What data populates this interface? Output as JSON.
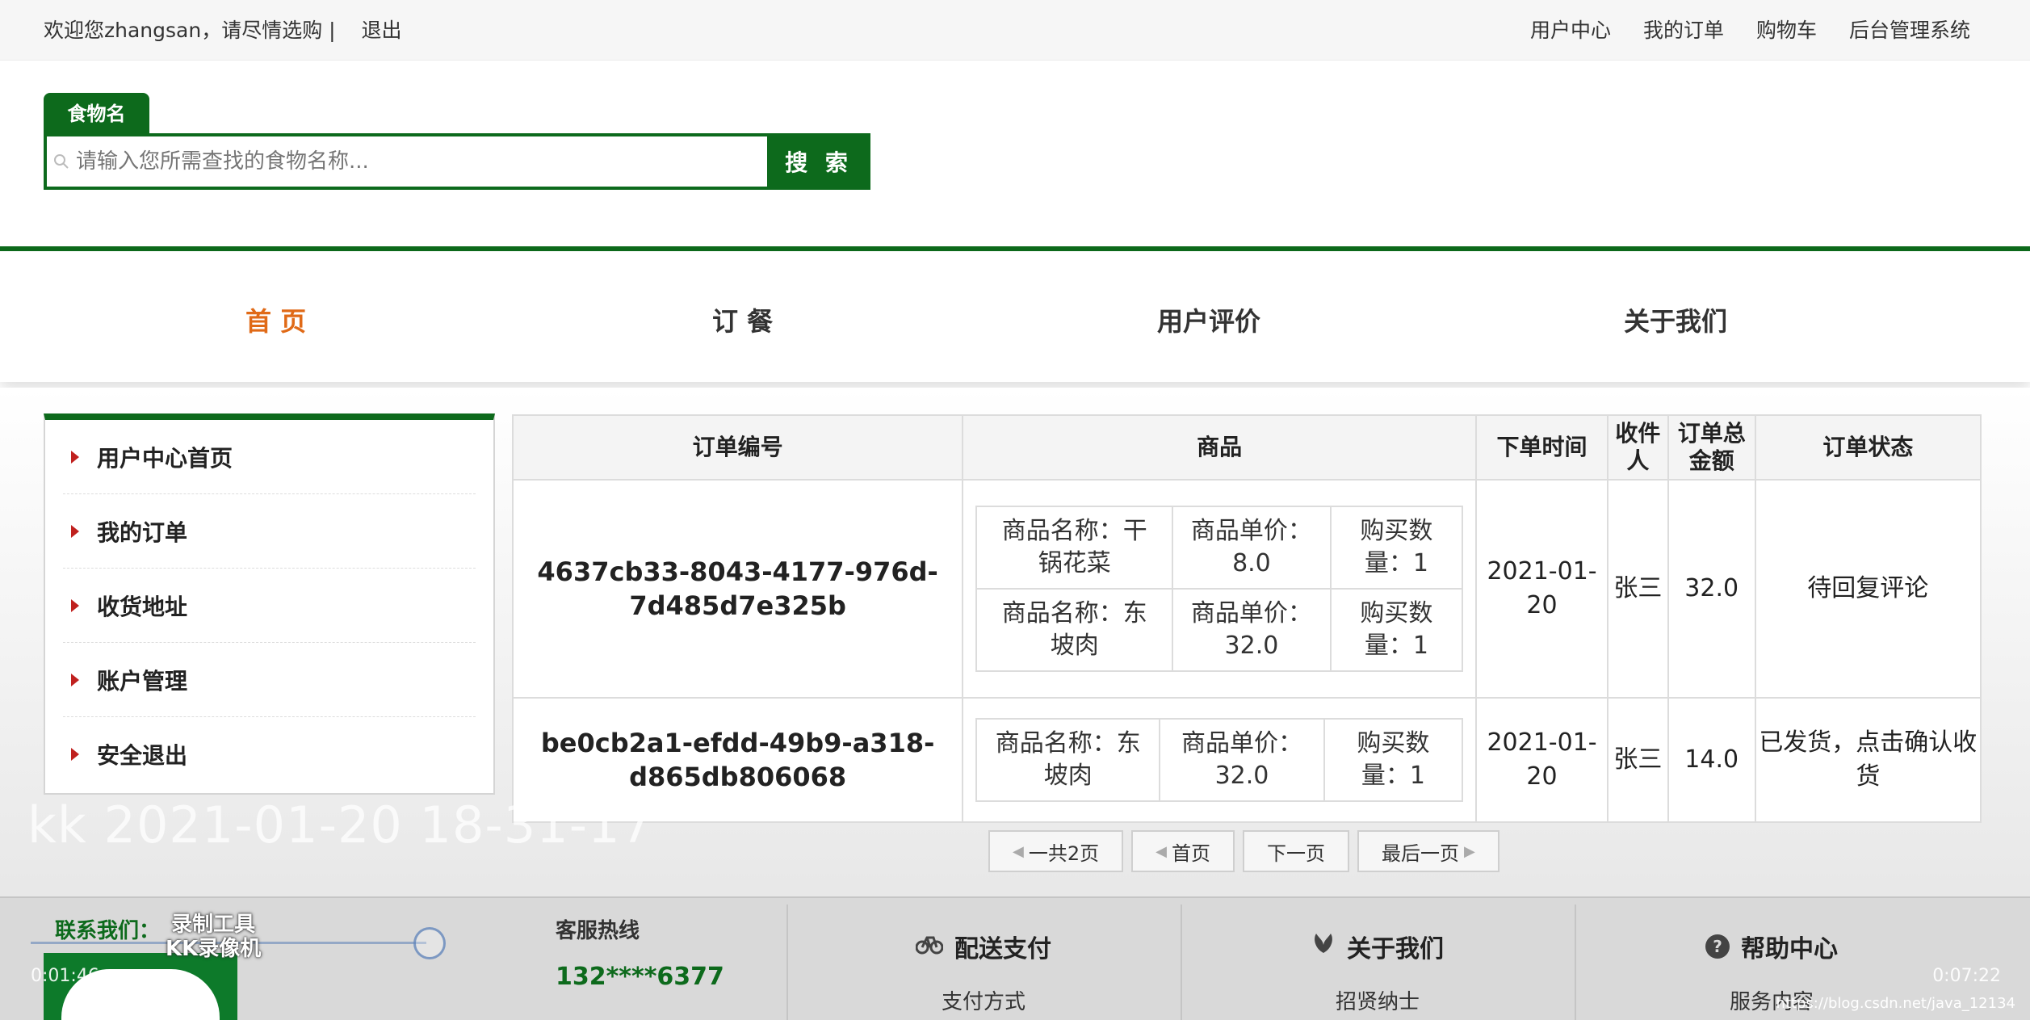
{
  "topbar": {
    "welcome": "欢迎您zhangsan，请尽情选购 |",
    "logout": "退出",
    "links": [
      "用户中心",
      "我的订单",
      "购物车",
      "后台管理系统"
    ]
  },
  "search": {
    "tab_label": "食物名",
    "placeholder": "请输入您所需查找的食物名称...",
    "button": "搜 索"
  },
  "nav": {
    "items": [
      "首 页",
      "订 餐",
      "用户评价",
      "关于我们"
    ],
    "active_index": 0
  },
  "sidebar": {
    "items": [
      "用户中心首页",
      "我的订单",
      "收货地址",
      "账户管理",
      "安全退出"
    ]
  },
  "orders": {
    "headers": {
      "id": "订单编号",
      "goods": "商品",
      "time": "下单时间",
      "receiver": "收件人",
      "total": "订单总金额",
      "status": "订单状态"
    },
    "rows": [
      {
        "id": "4637cb33-8043-4177-976d-7d485d7e325b",
        "items": [
          {
            "name": "商品名称：干锅花菜",
            "price": "商品单价：8.0",
            "qty": "购买数量：1"
          },
          {
            "name": "商品名称：东坡肉",
            "price": "商品单价：32.0",
            "qty": "购买数量：1"
          }
        ],
        "time": "2021-01-20",
        "receiver": "张三",
        "total": "32.0",
        "status": "待回复评论"
      },
      {
        "id": "be0cb2a1-efdd-49b9-a318-d865db806068",
        "items": [
          {
            "name": "商品名称：东坡肉",
            "price": "商品单价：32.0",
            "qty": "购买数量：1"
          }
        ],
        "time": "2021-01-20",
        "receiver": "张三",
        "total": "14.0",
        "status": "已发货，点击确认收货"
      }
    ]
  },
  "pager": {
    "total": "一共2页",
    "first": "首页",
    "next": "下一页",
    "last": "最后一页"
  },
  "watermark": "kk 2021-01-20 18-31-17",
  "footer": {
    "contact": "联系我们：",
    "hotline_label": "客服热线",
    "phone": "132****6377",
    "cols": [
      {
        "title": "配送支付",
        "sub": "支付方式",
        "icon": "bicycle-icon"
      },
      {
        "title": "关于我们",
        "sub": "招贤纳士",
        "icon": "leaf-icon"
      },
      {
        "title": "帮助中心",
        "sub": "服务内容",
        "icon": "question-icon"
      }
    ]
  },
  "recorder": {
    "logo_line1": "录制工具",
    "logo_line2": "KK录像机",
    "time_left": "0:01:46",
    "time_right": "0:07:22"
  },
  "blog_url": "https://blog.csdn.net/java_12134",
  "colors": {
    "brand_green": "#0d6a1c",
    "active_orange": "#e06a17",
    "bullet_red": "#c0211f"
  }
}
